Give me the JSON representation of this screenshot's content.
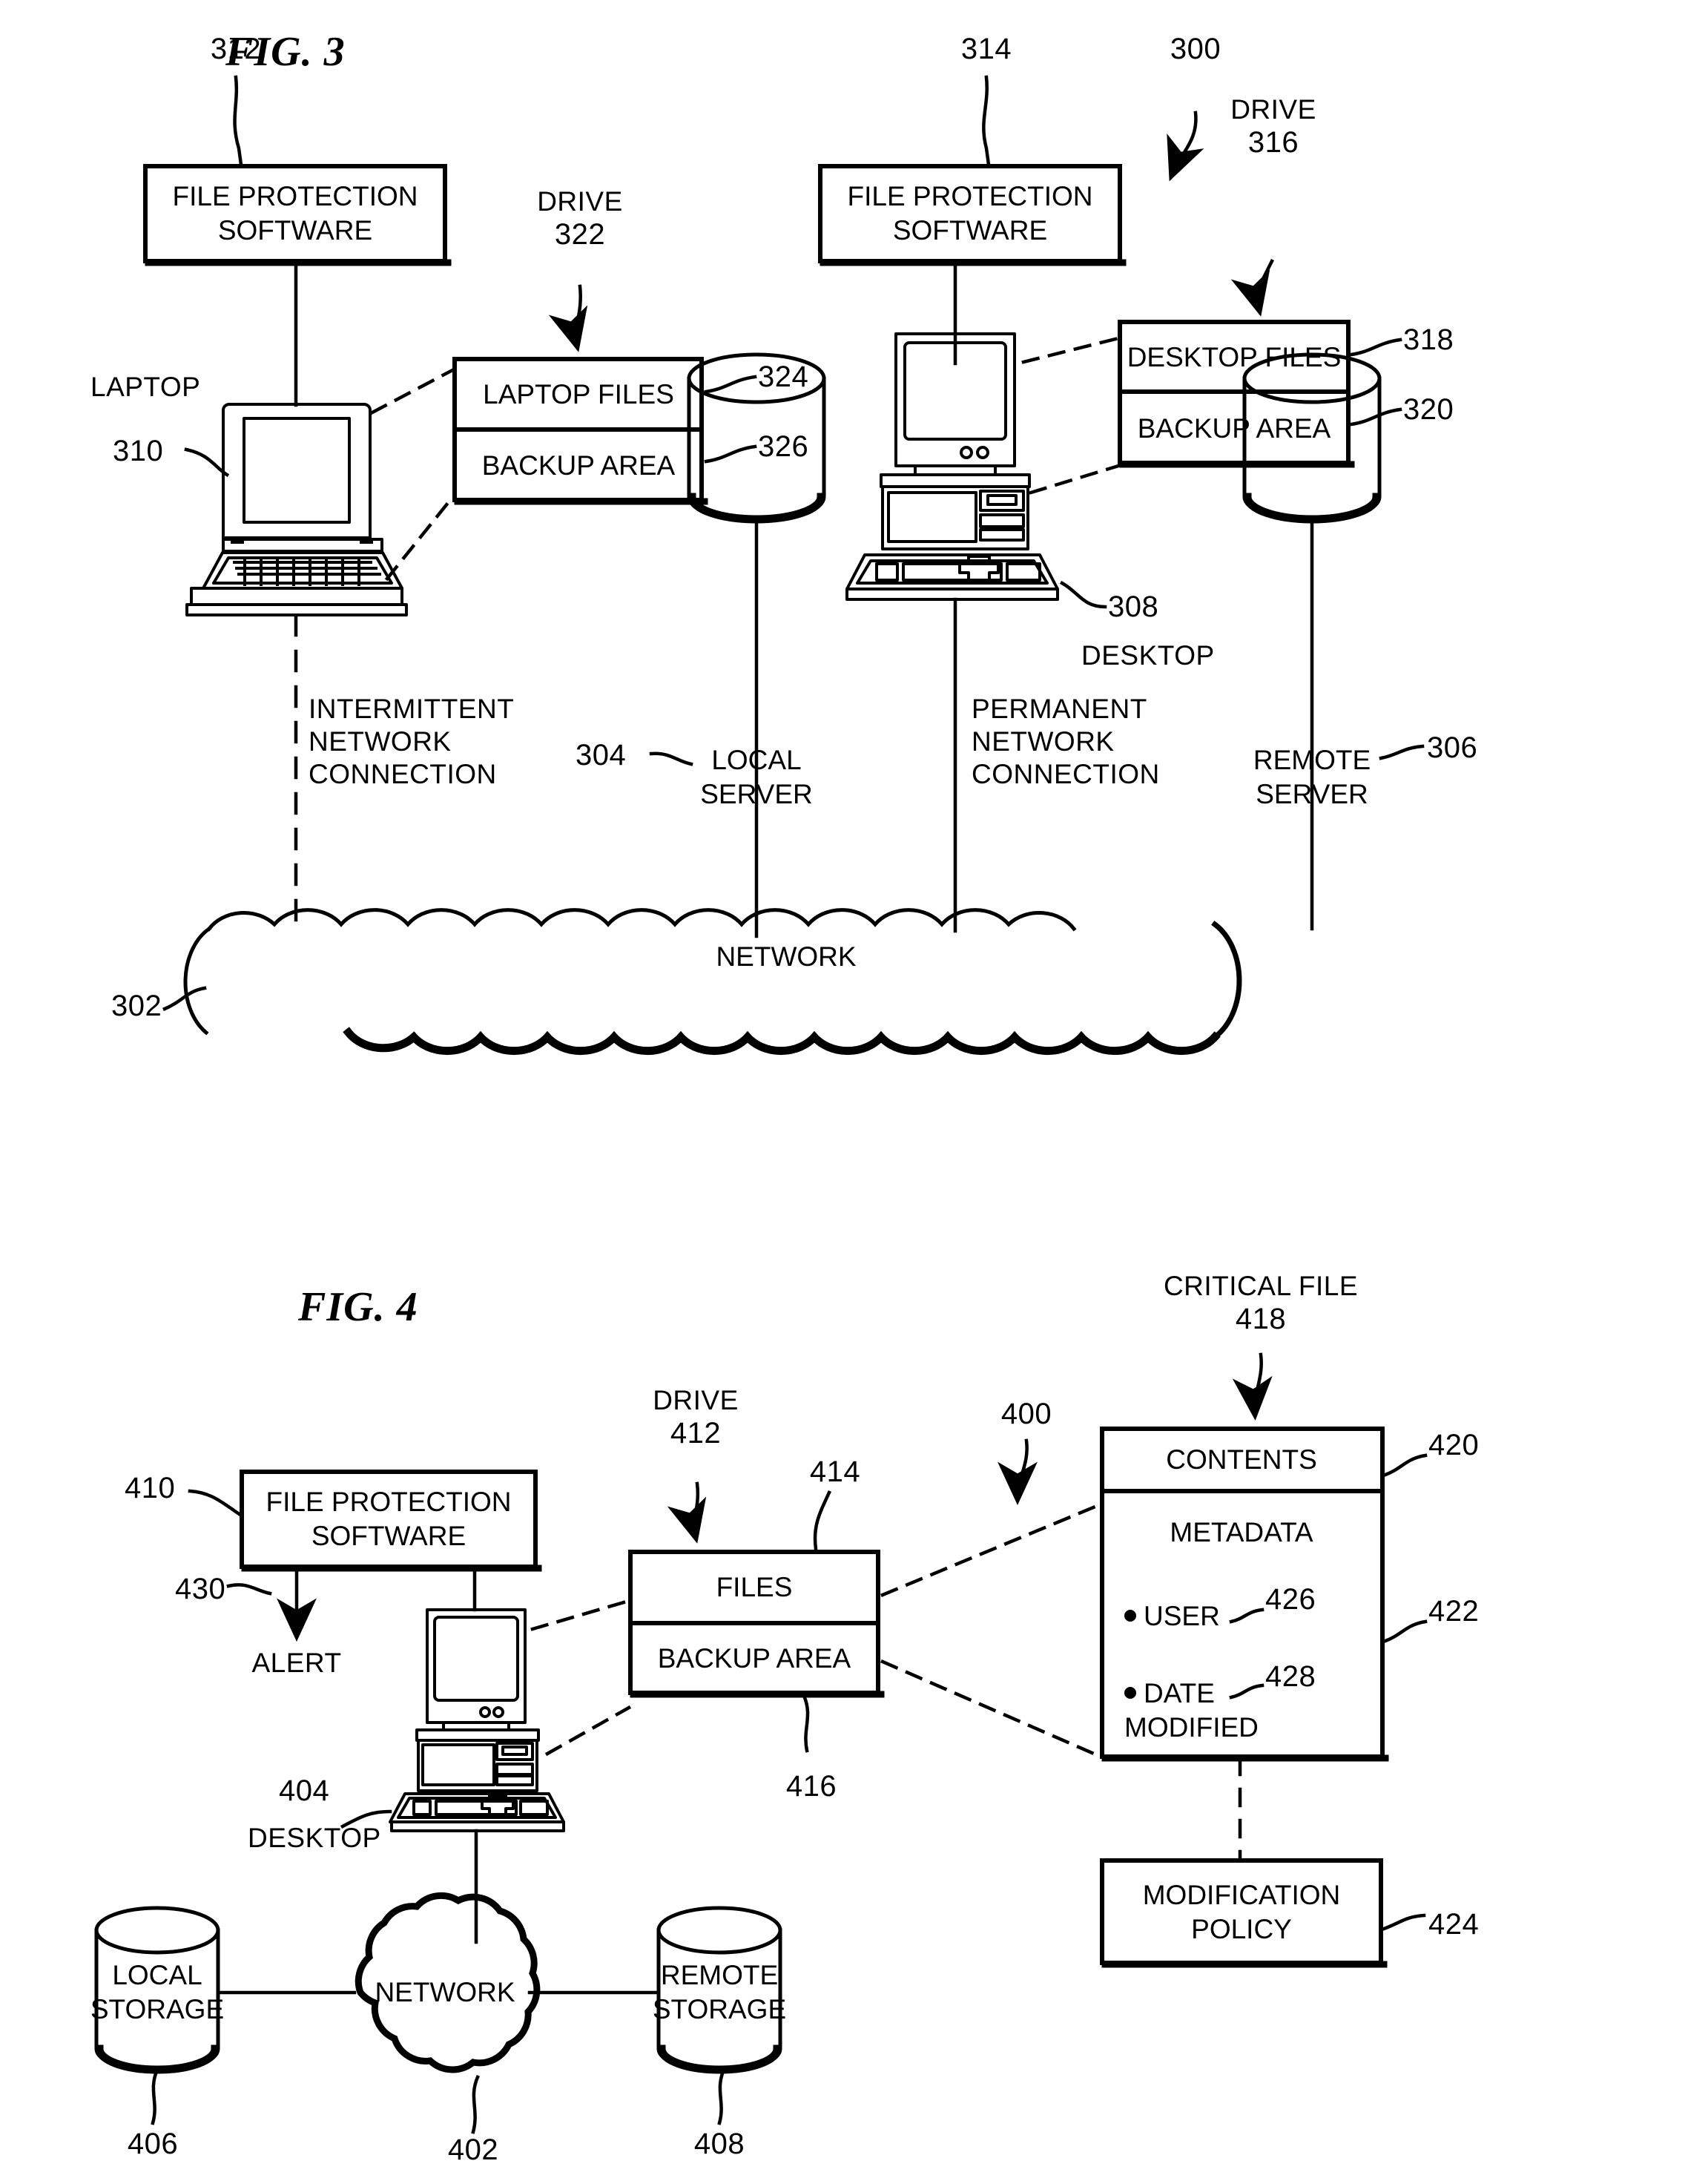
{
  "figures": [
    {
      "id": "fig3",
      "title": "FIG. 3",
      "system_ref": "300",
      "labels": {
        "fps_left": "FILE PROTECTION\nSOFTWARE",
        "fps_left_ref": "312",
        "fps_right": "FILE PROTECTION\nSOFTWARE",
        "fps_right_ref": "314",
        "drive_left_label": "DRIVE",
        "drive_left_ref": "322",
        "drive_right_label": "DRIVE",
        "drive_right_ref": "316",
        "laptop_label": "LAPTOP",
        "laptop_ref": "310",
        "laptop_files": "LAPTOP FILES",
        "laptop_files_ref": "324",
        "laptop_backup": "BACKUP AREA",
        "laptop_backup_ref": "326",
        "desktop_files": "DESKTOP FILES",
        "desktop_files_ref": "318",
        "desktop_backup": "BACKUP AREA",
        "desktop_backup_ref": "320",
        "desktop_ref": "308",
        "desktop_label": "DESKTOP",
        "intermittent": "INTERMITTENT\nNETWORK\nCONNECTION",
        "permanent": "PERMANENT\nNETWORK\nCONNECTION",
        "local_server": "LOCAL\nSERVER",
        "local_server_ref": "304",
        "remote_server": "REMOTE\nSERVER",
        "remote_server_ref": "306",
        "network": "NETWORK",
        "network_ref": "302"
      }
    },
    {
      "id": "fig4",
      "title": "FIG. 4",
      "system_ref": "400",
      "labels": {
        "fps": "FILE PROTECTION\nSOFTWARE",
        "fps_ref": "410",
        "alert_ref": "430",
        "alert": "ALERT",
        "drive_label": "DRIVE",
        "drive_ref": "412",
        "files": "FILES",
        "files_ref": "414",
        "backup_area": "BACKUP AREA",
        "backup_area_ref": "416",
        "desktop_ref": "404",
        "desktop_label": "DESKTOP",
        "local_storage": "LOCAL\nSTORAGE",
        "local_storage_ref": "406",
        "network": "NETWORK",
        "network_ref": "402",
        "remote_storage": "REMOTE\nSTORAGE",
        "remote_storage_ref": "408",
        "critical_file": "CRITICAL FILE",
        "critical_file_ref": "418",
        "contents": "CONTENTS",
        "contents_ref": "420",
        "metadata": "METADATA",
        "metadata_ref": "422",
        "meta_user": "USER",
        "meta_user_ref": "426",
        "meta_date": "DATE",
        "meta_date_2": "MODIFIED",
        "meta_date_ref": "428",
        "modification_policy": "MODIFICATION\nPOLICY",
        "modification_policy_ref": "424"
      }
    }
  ],
  "colors": {
    "ink": "#000000",
    "paper": "#ffffff"
  }
}
